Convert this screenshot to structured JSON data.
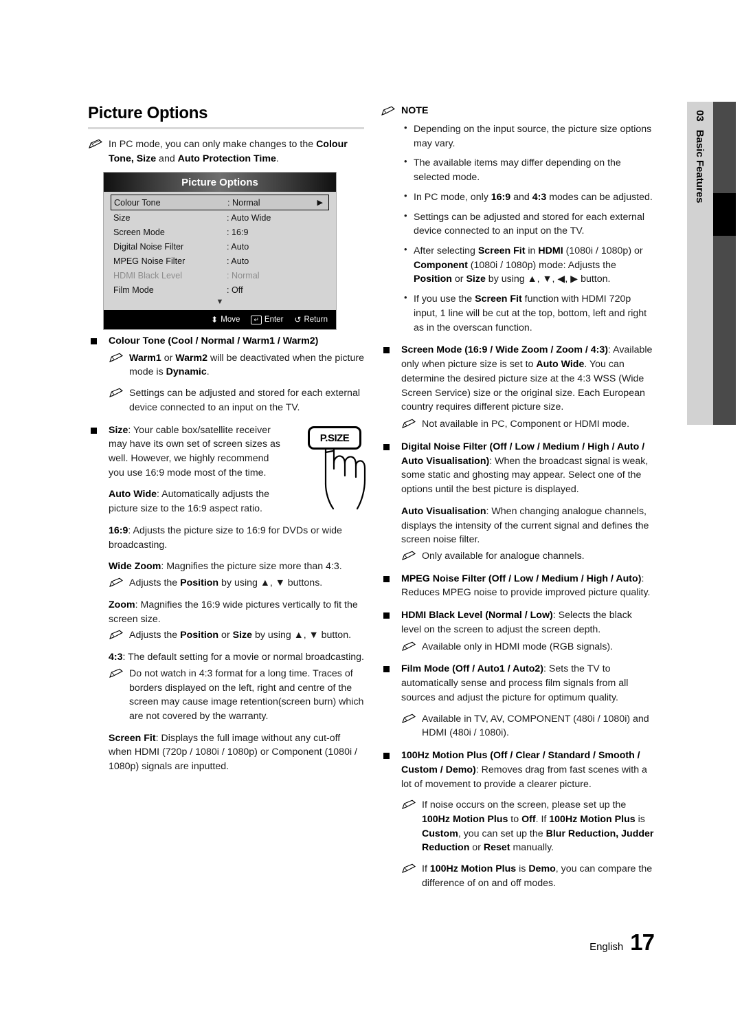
{
  "chapter_tab": {
    "number": "03",
    "name": "Basic Features"
  },
  "page_title": "Picture Options",
  "left": {
    "intro_note": "In PC mode, you can only make changes to the <b>Colour Tone, Size</b> and <b>Auto Protection Time</b>.",
    "osd": {
      "title": "Picture Options",
      "rows": [
        {
          "label": "Colour Tone",
          "value": ": Normal",
          "state": "selected"
        },
        {
          "label": "Size",
          "value": ": Auto Wide",
          "state": "normal"
        },
        {
          "label": "Screen Mode",
          "value": ": 16:9",
          "state": "normal"
        },
        {
          "label": "Digital Noise Filter",
          "value": ": Auto",
          "state": "normal"
        },
        {
          "label": "MPEG Noise Filter",
          "value": ": Auto",
          "state": "normal"
        },
        {
          "label": "HDMI Black Level",
          "value": ": Normal",
          "state": "disabled"
        },
        {
          "label": "Film Mode",
          "value": ": Off",
          "state": "normal"
        }
      ],
      "scroll_indicator": "▼",
      "footer_keys": [
        {
          "glyph": "⬍",
          "label": "Move"
        },
        {
          "glyph": "↵",
          "label": "Enter"
        },
        {
          "glyph": "↺",
          "label": "Return"
        }
      ]
    },
    "colour_tone_item": "<b>Colour Tone (Cool / Normal / Warm1 / Warm2)</b>",
    "colour_tone_notes": [
      "<b>Warm1</b> or <b>Warm2</b> will be deactivated when the picture mode is <b>Dynamic</b>.",
      "Settings can be adjusted and stored for each external device connected to an input on the TV."
    ],
    "size_item": "<b>Size</b>: Your cable box/satellite receiver may have its own set of screen sizes as well. However, we highly recommend you use 16:9 mode most of the time.",
    "size_modes": [
      "<b>Auto Wide</b>: Automatically adjusts the picture size to the 16:9 aspect ratio.",
      "<b>16:9</b>: Adjusts the picture size to 16:9 for DVDs or wide broadcasting.",
      "<b>Wide Zoom</b>: Magnifies the picture size more than 4:3."
    ],
    "wide_zoom_note": "Adjusts the <b>Position</b> by using ▲, ▼ buttons.",
    "zoom_text": "<b>Zoom</b>: Magnifies the 16:9 wide pictures vertically to fit the screen size.",
    "zoom_note": "Adjusts the <b>Position</b> or <b>Size</b> by using ▲, ▼ button.",
    "ratio43_text": "<b>4:3</b>: The default setting for a movie or normal broadcasting.",
    "ratio43_note": "Do not watch in 4:3 format for a long time. Traces of borders displayed on the left, right and centre of the screen may cause image retention(screen burn) which are not covered by the warranty.",
    "screen_fit_text": "<b>Screen Fit</b>: Displays the full image without any cut-off when HDMI (720p / 1080i / 1080p) or Component (1080i / 1080p) signals are inputted.",
    "psize_button_label": "P.SIZE"
  },
  "right": {
    "note_heading": "NOTE",
    "note_bullets": [
      "Depending on the input source, the picture size options may vary.",
      "The available items may differ depending on the selected mode.",
      "In PC mode, only <b>16:9</b> and <b>4:3</b> modes can be adjusted.",
      "Settings can be adjusted and stored for each external device connected to an input on the TV.",
      "After selecting <b>Screen Fit</b> in <b>HDMI</b> (1080i / 1080p) or <b>Component</b> (1080i / 1080p) mode: Adjusts the <b>Position</b> or <b>Size</b> by using ▲, ▼, ◀, ▶ button.",
      "If you use the <b>Screen Fit</b> function with HDMI 720p input, 1 line will be cut at the top, bottom, left and right as in the overscan function."
    ],
    "screen_mode_item": "<b>Screen Mode (16:9 / Wide Zoom / Zoom / 4:3)</b>: Available only when picture size is set to <b>Auto Wide</b>. You can determine the desired picture size at the 4:3 WSS (Wide Screen Service) size or the original size. Each European country requires different picture size.",
    "screen_mode_note": "Not available in PC, Component or HDMI mode.",
    "dnf_item": "<b>Digital Noise Filter (Off / Low / Medium / High / Auto / Auto Visualisation)</b>: When the broadcast signal is weak, some static and ghosting may appear. Select one of the options until the best picture is displayed.",
    "auto_vis_text": "<b>Auto Visualisation</b>: When changing analogue channels, displays the intensity of the current signal and defines the screen noise filter.",
    "auto_vis_note": "Only available for analogue channels.",
    "mpeg_item": "<b>MPEG Noise Filter (Off / Low / Medium / High / Auto)</b>: Reduces MPEG noise to provide improved picture quality.",
    "hdmi_black_item": "<b>HDMI Black Level (Normal / Low)</b>: Selects the black level on the screen to adjust the screen depth.",
    "hdmi_black_note": "Available only in HDMI mode (RGB signals).",
    "film_mode_item": "<b>Film Mode (Off / Auto1 / Auto2)</b>: Sets the TV to automatically sense and process film signals from all sources and adjust the picture for optimum quality.",
    "film_mode_note": "Available in TV, AV, COMPONENT (480i / 1080i) and HDMI (480i / 1080i).",
    "motion_plus_item": "<b>100Hz Motion Plus (Off / Clear / Standard / Smooth / Custom / Demo)</b>: Removes drag from fast scenes with a lot of movement to provide a clearer picture.",
    "motion_plus_note1": "If noise occurs on the screen, please set up the <b>100Hz Motion Plus</b> to <b>Off</b>. If <b>100Hz Motion Plus</b> is <b>Custom</b>, you can set up the <b>Blur Reduction, Judder Reduction</b> or <b>Reset</b> manually.",
    "motion_plus_note2": "If <b>100Hz Motion Plus</b> is <b>Demo</b>, you can compare the difference of on and off modes."
  },
  "footer": {
    "language": "English",
    "page_number": "17"
  }
}
